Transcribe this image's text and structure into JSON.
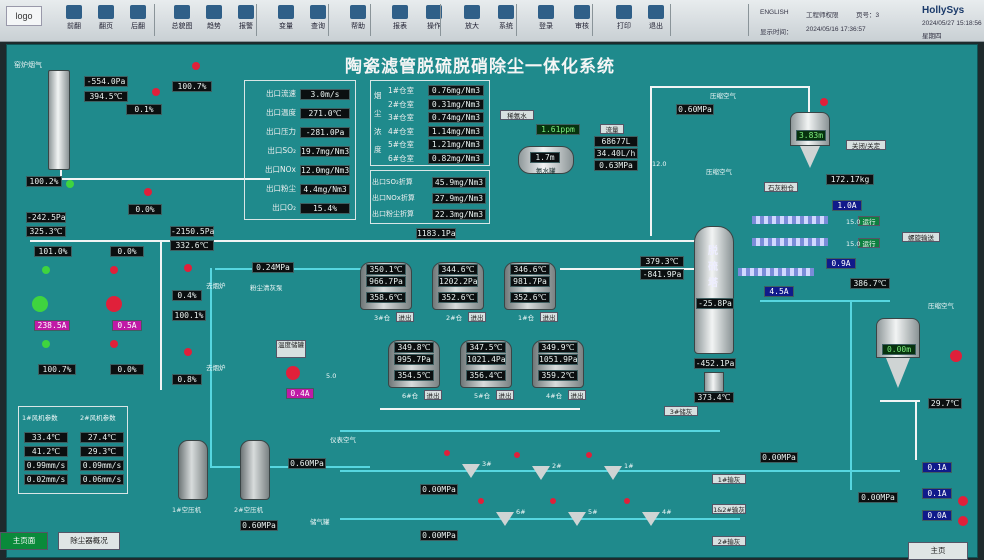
{
  "toolbar": {
    "logo": "logo",
    "buttons": [
      "前翻",
      "翻页",
      "后翻",
      "总貌图",
      "趋势",
      "报警",
      "变量",
      "查询",
      "帮助",
      "报表",
      "操作",
      "放大",
      "系统",
      "登录",
      "审核",
      "打印",
      "退出"
    ],
    "lang": "ENGLISH",
    "station": "工程师权限",
    "page": "页号：3",
    "time_label": "显示时间：",
    "datetime": "2024/05/16 17:36:57",
    "brand": "HollySys",
    "sysdate": "2024/05/27 15:18:56",
    "weekday": "星期四"
  },
  "title": "陶瓷滤管脱硫脱硝除尘一体化系统",
  "left": {
    "furnace": "窑炉烟气",
    "p1": "-554.0Pa",
    "t1": "394.5℃",
    "v1": "100.7%",
    "v2": "0.1%",
    "v3": "100.2%",
    "v4": "0.0%",
    "p2": "-242.5Pa",
    "t2": "325.3℃",
    "v5": "101.0%",
    "v6": "0.0%",
    "v7": "0.4%",
    "v8": "100.1%",
    "v9": "0.0%",
    "v10": "100.7%",
    "v11": "0.0%",
    "v12": "0.8%",
    "amp1": "238.5A",
    "amp2": "0.5A",
    "p3": "-2150.5Pa",
    "t3": "332.6℃",
    "fan_a": "1#风机",
    "fan_b": "2#风机",
    "label_a": "去烟炉",
    "label_b": "去烟炉"
  },
  "outlet": [
    {
      "k": "出口流速",
      "v": "3.0m/s"
    },
    {
      "k": "出口温度",
      "v": "271.0℃"
    },
    {
      "k": "出口压力",
      "v": "-281.0Pa"
    },
    {
      "k": "出口SO₂",
      "v": "19.7mg/Nm3"
    },
    {
      "k": "出口NOx",
      "v": "12.0mg/Nm3"
    },
    {
      "k": "出口粉尘",
      "v": "4.4mg/Nm3"
    },
    {
      "k": "出口O₂",
      "v": "15.4%"
    }
  ],
  "dust": {
    "side": [
      "烟",
      "尘",
      "浓",
      "度"
    ],
    "rows": [
      {
        "k": "1#仓室",
        "v": "0.76mg/Nm3"
      },
      {
        "k": "2#仓室",
        "v": "0.31mg/Nm3"
      },
      {
        "k": "3#仓室",
        "v": "0.74mg/Nm3"
      },
      {
        "k": "4#仓室",
        "v": "1.14mg/Nm3"
      },
      {
        "k": "5#仓室",
        "v": "1.21mg/Nm3"
      },
      {
        "k": "6#仓室",
        "v": "0.82mg/Nm3"
      }
    ]
  },
  "conv": [
    {
      "k": "出口SO₂折算",
      "v": "45.9mg/Nm3"
    },
    {
      "k": "出口NOx折算",
      "v": "27.9mg/Nm3"
    },
    {
      "k": "出口粉尘折算",
      "v": "22.3mg/Nm3"
    }
  ],
  "ammonia": {
    "tag": "稀氨水",
    "ppm": "1.61ppm",
    "flow_label": "流量",
    "flow": "68677L",
    "rate": "34.40L/h",
    "press": "0.63MPa",
    "tank": "1.7m",
    "tank_name": "氨水罐",
    "v": "12.0",
    "air": "压缩空气",
    "airp": "0.60MPa"
  },
  "main_press": "1183.1Pa",
  "air_press": "0.24MPa",
  "dust_removal": "粉尘清灰泵",
  "chambers": [
    {
      "t": "350.1℃",
      "p": "966.7Pa",
      "t2": "358.6℃",
      "name": "3#仓"
    },
    {
      "t": "344.6℃",
      "p": "1202.2Pa",
      "t2": "352.6℃",
      "name": "2#仓"
    },
    {
      "t": "346.6℃",
      "p": "981.7Pa",
      "t2": "352.6℃",
      "name": "1#仓"
    },
    {
      "t": "349.8℃",
      "p": "995.7Pa",
      "t2": "354.5℃",
      "name": "6#仓"
    },
    {
      "t": "347.5℃",
      "p": "1021.4Pa",
      "t2": "356.4℃",
      "name": "5#仓"
    },
    {
      "t": "349.9℃",
      "p": "1051.9Pa",
      "t2": "359.2℃",
      "name": "4#仓"
    }
  ],
  "chamber_btn": "进出",
  "tower": {
    "name": [
      "脱",
      "硫",
      "塔"
    ],
    "t": "379.3℃",
    "p": "-841.9Pa",
    "p2": "-25.8Pa",
    "p3": "-452.1Pa",
    "t2": "373.4℃",
    "pump": "3#储灰"
  },
  "silo": {
    "level": "3.83m",
    "weight": "172.17kg",
    "label": "关闭/关定",
    "air": "压缩空气",
    "feeder": "石灰粉仓",
    "amp": "1.0A",
    "amp2": "0.9A",
    "amp3": "4.5A",
    "v1": "15.0",
    "v2": "15.0",
    "run1": "运行",
    "run2": "运行",
    "screw": "螺旋输送",
    "temp": "386.7℃"
  },
  "ash": {
    "level": "0.00m",
    "temp": "29.7℃",
    "amp": "0.1A",
    "amp2": "0.1A",
    "amp3": "0.0A",
    "press": "0.00MPa",
    "label": "压缩空气"
  },
  "fans": {
    "fan_hdr": "风机参数",
    "c1": "1#风机参数",
    "c2": "2#风机参数",
    "r1": [
      "33.4℃",
      "27.4℃"
    ],
    "r2": [
      "41.2℃",
      "29.3℃"
    ],
    "r3": [
      "0.99mm/s",
      "0.09mm/s"
    ],
    "r4": [
      "0.02mm/s",
      "0.06mm/s"
    ]
  },
  "comp": {
    "p1": "0.60MPa",
    "p2": "0.60MPa",
    "n1": "1#空压机",
    "n2": "2#空压机",
    "out": "储气罐",
    "amp": "0.4A",
    "v": "5.0",
    "tank_lbl": "温度储罐"
  },
  "conveyor": {
    "p1": "0.00MPa",
    "p2": "0.00MPa",
    "p3": "0.00MPa",
    "p4": "0.00MPa",
    "b1": "1#输灰",
    "b2": "1&2#输灰",
    "b3": "2#输灰",
    "h": [
      "3#",
      "2#",
      "1#",
      "6#",
      "5#",
      "4#"
    ],
    "air": "仪表空气"
  },
  "bottom": {
    "b1": "主页面",
    "b2": "除尘器概况",
    "home": "主页"
  }
}
